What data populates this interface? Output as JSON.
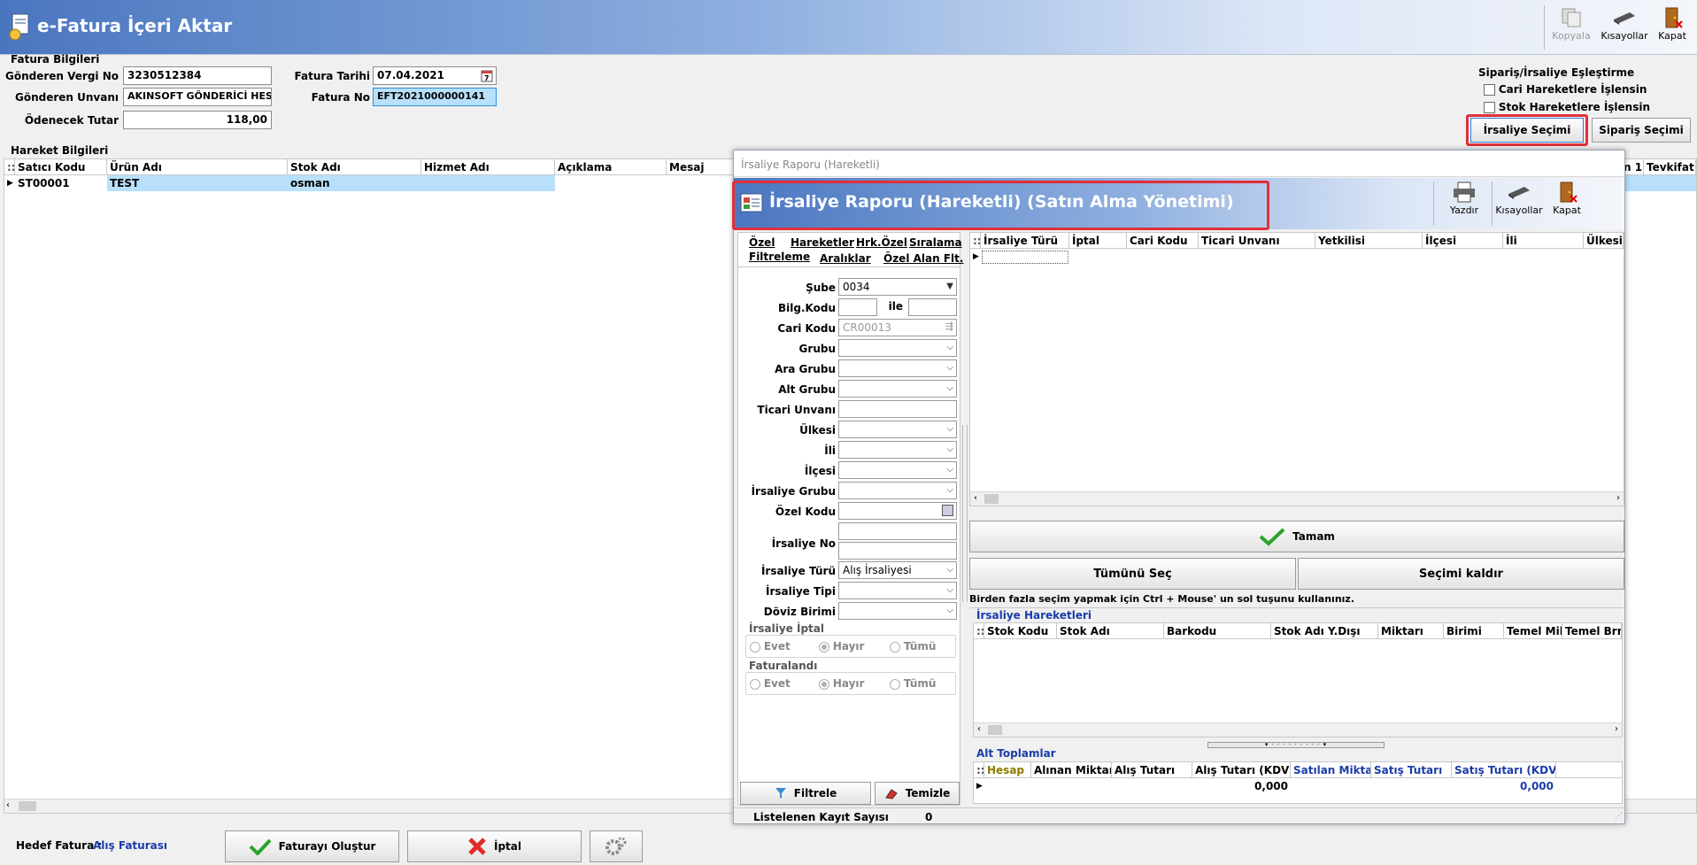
{
  "window": {
    "title": "e-Fatura İçeri Aktar"
  },
  "toolbar": {
    "copy": "Kopyala",
    "shortcuts": "Kısayollar",
    "close": "Kapat"
  },
  "invoice": {
    "section": "Fatura Bilgileri",
    "sender_tax_label": "Gönderen Vergi No",
    "sender_tax_value": "3230512384",
    "sender_title_label": "Gönderen Unvanı",
    "sender_title_value": "AKINSOFT GÖNDERİCİ HESAP",
    "amount_label": "Ödenecek Tutar",
    "amount_value": "118,00",
    "date_label": "Fatura Tarihi",
    "date_value": "07.04.2021",
    "no_label": "Fatura No",
    "no_value": "EFT2021000000141"
  },
  "matching": {
    "title": "Sipariş/İrsaliye Eşleştirme",
    "cari_label": "Cari Hareketlere İşlensin",
    "stok_label": "Stok Hareketlere İşlensin",
    "irsaliye_btn": "İrsaliye Seçimi",
    "siparis_btn": "Sipariş Seçimi"
  },
  "movements": {
    "section": "Hareket Bilgileri",
    "columns": [
      "Satıcı Kodu",
      "Ürün Adı",
      "Stok Adı",
      "Hizmet Adı",
      "Açıklama",
      "Mesaj"
    ],
    "right_cols": [
      "n 1",
      "Tevkifat C"
    ],
    "rows": [
      [
        "ST00001",
        "TEST",
        "osman",
        "",
        "",
        ""
      ]
    ]
  },
  "footer": {
    "target_label": "Hedef Fatura :",
    "target_value": "Alış Faturası",
    "create_btn": "Faturayı Oluştur",
    "cancel_btn": "İptal"
  },
  "dialog": {
    "titlebar": "İrsaliye Raporu (Hareketli)",
    "header": "İrsaliye Raporu (Hareketli) (Satın Alma Yönetimi)",
    "toolbar": {
      "print": "Yazdır",
      "shortcuts": "Kısayollar",
      "close": "Kapat"
    },
    "tabs_row1": [
      "Özel",
      "Hareketler",
      "Hrk.Özel",
      "Sıralama"
    ],
    "tabs_row2": [
      "Filtreleme",
      "Aralıklar",
      "Özel Alan Flt."
    ],
    "filters": {
      "sube_label": "Şube",
      "sube_value": "0034",
      "bilg_label": "Bilg.Kodu",
      "ile": "ile",
      "cari_label": "Cari Kodu",
      "cari_value": "CR00013",
      "grubu": "Grubu",
      "ara_grubu": "Ara Grubu",
      "alt_grubu": "Alt Grubu",
      "ticari": "Ticari Unvanı",
      "ulkesi": "Ülkesi",
      "ili": "İli",
      "ilcesi": "İlçesi",
      "irs_grubu": "İrsaliye Grubu",
      "ozel_kodu": "Özel Kodu",
      "irs_no": "İrsaliye No",
      "irs_turu_label": "İrsaliye Türü",
      "irs_turu_value": "Alış İrsaliyesi",
      "irs_tipi": "İrsaliye Tipi",
      "doviz": "Döviz Birimi"
    },
    "iptal_group": {
      "title": "İrsaliye İptal",
      "opt1": "Evet",
      "opt2": "Hayır",
      "opt3": "Tümü"
    },
    "fatura_group": {
      "title": "Faturalandı",
      "opt1": "Evet",
      "opt2": "Hayır",
      "opt3": "Tümü"
    },
    "filter_btn": "Filtrele",
    "clear_btn": "Temizle",
    "count_label": "Listelenen Kayıt Sayısı",
    "count_value": "0",
    "main_columns": [
      "İrsaliye Türü",
      "İptal",
      "Cari Kodu",
      "Ticari Unvanı",
      "Yetkilisi",
      "İlçesi",
      "İli",
      "Ülkesi"
    ],
    "ok_btn": "Tamam",
    "select_all_btn": "Tümünü Seç",
    "deselect_btn": "Seçimi kaldır",
    "hint": "Birden fazla seçim yapmak için Ctrl + Mouse' un sol tuşunu kullanınız.",
    "detail_title": "İrsaliye Hareketleri",
    "detail_columns": [
      "Stok Kodu",
      "Stok Adı",
      "Barkodu",
      "Stok Adı Y.Dışı",
      "Miktarı",
      "Birimi",
      "Temel Mik.",
      "Temel Brm"
    ],
    "totals_title": "Alt Toplamlar",
    "totals_columns": [
      "Hesap",
      "Alınan Miktar",
      "Alış Tutarı",
      "Alış Tutarı (KDV li)",
      "Satılan Miktar",
      "Satış Tutarı",
      "Satış Tutarı (KDV li)"
    ],
    "totals_alis_kdv": "0,000",
    "totals_satis_kdv": "0,000"
  }
}
